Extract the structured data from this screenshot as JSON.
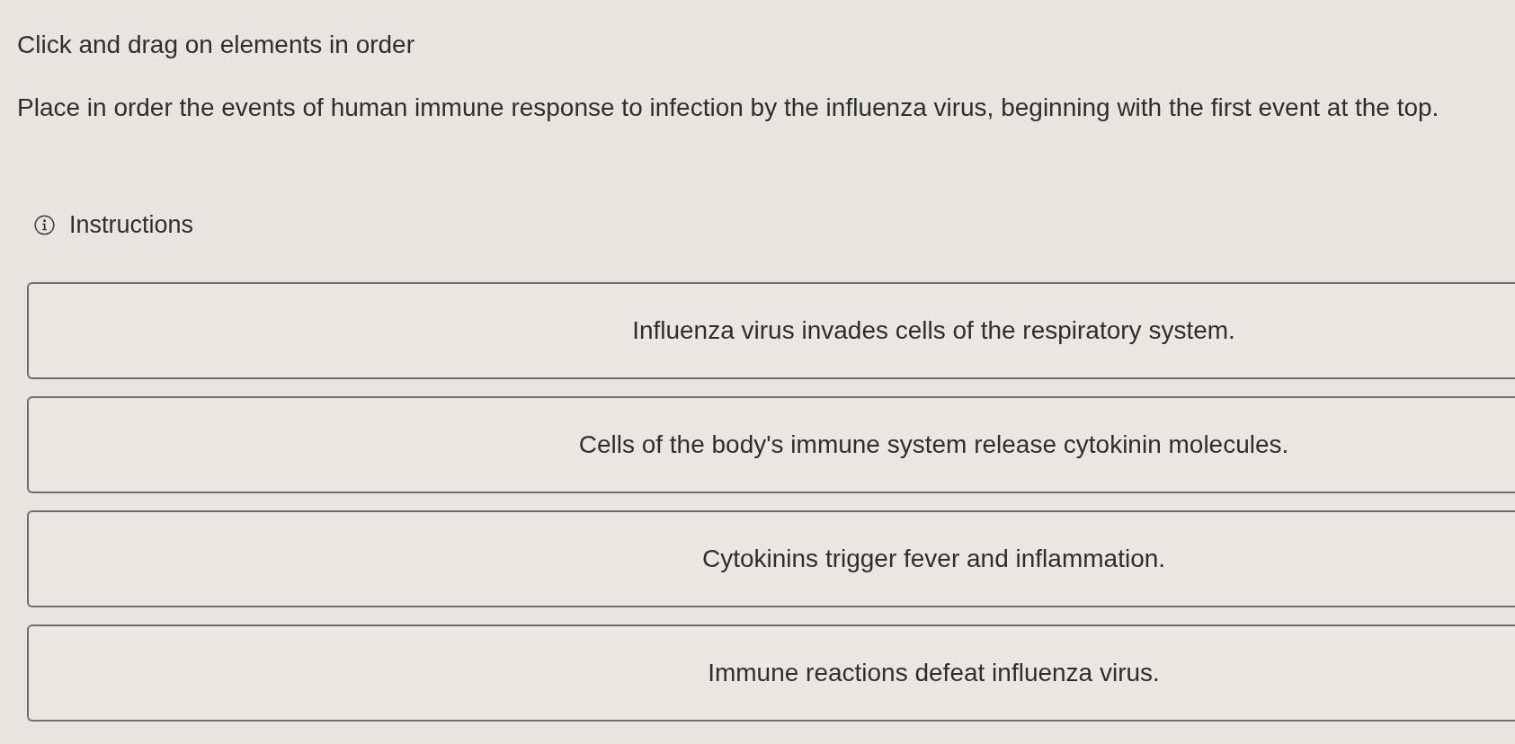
{
  "heading": "Click and drag on elements in order",
  "prompt": "Place in order the events of human immune response to infection by the influenza virus, beginning with the first event at the top.",
  "instructions_toggle": {
    "label": "Instructions"
  },
  "items": [
    {
      "text": "Influenza virus invades cells of the respiratory system."
    },
    {
      "text": "Cells of the body's immune system release cytokinin molecules."
    },
    {
      "text": "Cytokinins trigger fever and inflammation."
    },
    {
      "text": "Immune reactions defeat influenza virus."
    }
  ]
}
